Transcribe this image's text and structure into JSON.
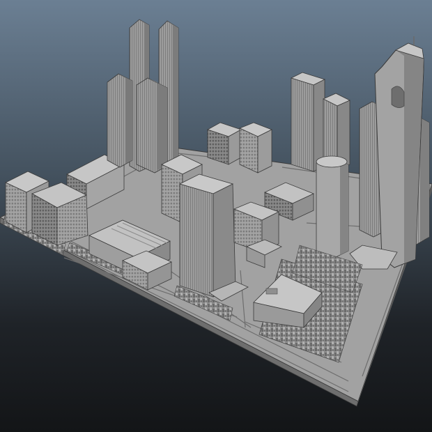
{
  "viewport": {
    "background_top": "#6b7f93",
    "background_bottom": "#131517",
    "model_color": "#a9a9a9",
    "edge_color": "#3a3a3a"
  },
  "scene": {
    "object_name": "city-block-model",
    "style": "untextured grey 3D viewport render"
  }
}
